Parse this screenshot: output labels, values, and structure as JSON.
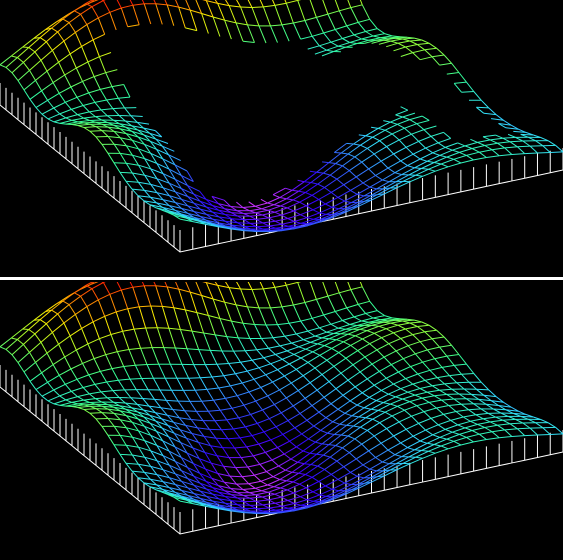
{
  "figure": {
    "background": "#000000",
    "divider_color": "#ffffff",
    "base_wall_color": "#ffffff",
    "colormap": [
      "#ff0000",
      "#ff8800",
      "#ffee00",
      "#99ff33",
      "#33ff99",
      "#33ddff",
      "#3366ff",
      "#3300ff",
      "#cc33ff"
    ]
  },
  "panels": [
    {
      "id": "top",
      "rendering": "wireframe-surface-with-missing-cells"
    },
    {
      "id": "bottom",
      "rendering": "wireframe-surface-complete"
    }
  ]
}
